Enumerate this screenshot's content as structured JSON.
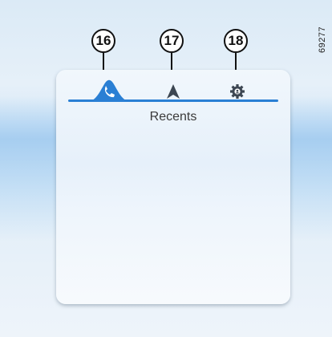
{
  "figure_ref": "69277",
  "callouts": [
    "16",
    "17",
    "18"
  ],
  "tabs": [
    {
      "name": "recents",
      "icon": "phone-icon",
      "active": true
    },
    {
      "name": "navigation",
      "icon": "navigation-arrow-icon",
      "active": false
    },
    {
      "name": "settings",
      "icon": "settings-gear-icon",
      "active": false
    }
  ],
  "panel": {
    "title": "Recents"
  },
  "colors": {
    "accent": "#2a7fd4",
    "icon_dark": "#3c4652"
  }
}
